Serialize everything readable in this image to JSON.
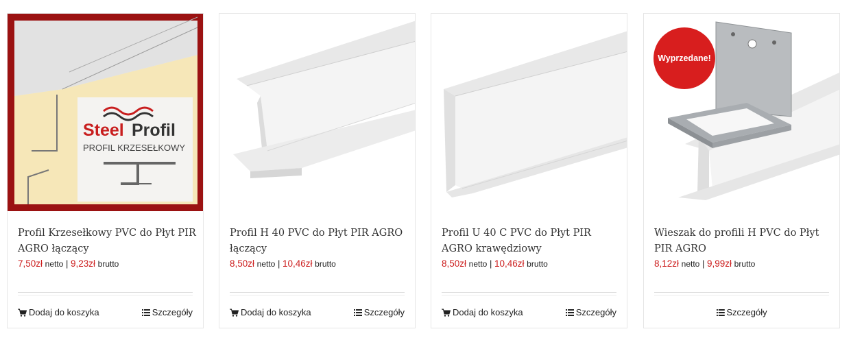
{
  "colors": {
    "price": "#cc1d1d",
    "badge": "#d81e1e",
    "frame": "#9b1212"
  },
  "products": [
    {
      "title": "Profil Krzesełkowy PVC do Płyt PIR AGRO łączący",
      "price_net": "7,50zł",
      "net_label": "netto",
      "separator": "|",
      "price_gross": "9,23zł",
      "gross_label": "brutto",
      "add_to_cart": "Dodaj do koszyka",
      "details": "Szczegóły",
      "image_text": {
        "brand_a": "Steel",
        "brand_b": "Profil",
        "subtitle": "PROFIL KRZESEŁKOWY"
      }
    },
    {
      "title": "Profil H 40 PVC do Płyt PIR AGRO łączący",
      "price_net": "8,50zł",
      "net_label": "netto",
      "separator": "|",
      "price_gross": "10,46zł",
      "gross_label": "brutto",
      "add_to_cart": "Dodaj do koszyka",
      "details": "Szczegóły"
    },
    {
      "title": "Profil U 40 C PVC do Płyt PIR AGRO krawędziowy",
      "price_net": "8,50zł",
      "net_label": "netto",
      "separator": "|",
      "price_gross": "10,46zł",
      "gross_label": "brutto",
      "add_to_cart": "Dodaj do koszyka",
      "details": "Szczegóły"
    },
    {
      "title": "Wieszak do profili H PVC do Płyt PIR AGRO",
      "price_net": "8,12zł",
      "net_label": "netto",
      "separator": "|",
      "price_gross": "9,99zł",
      "gross_label": "brutto",
      "badge": "Wyprzedane!",
      "details": "Szczegóły"
    }
  ],
  "icons": {
    "cart": "cart-icon",
    "details": "list-icon"
  }
}
